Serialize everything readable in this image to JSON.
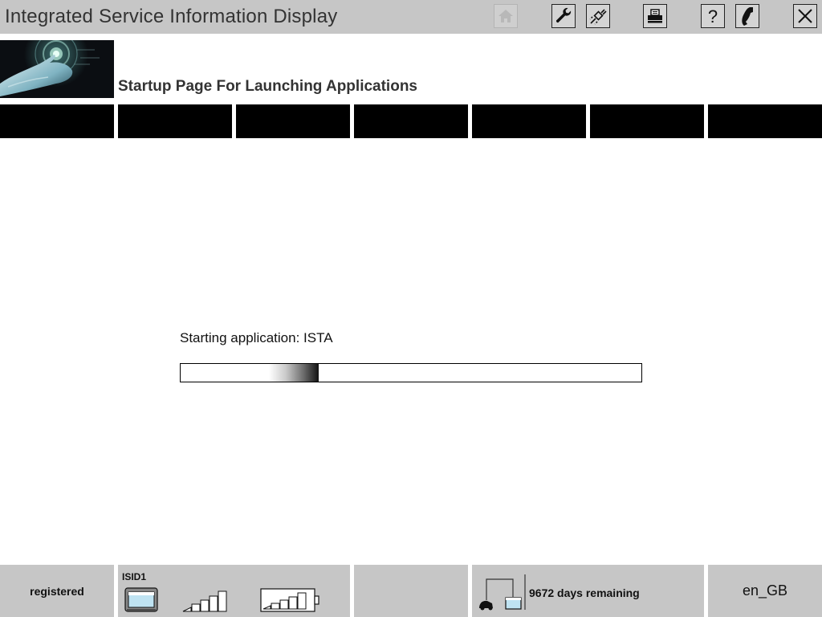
{
  "header": {
    "app_title": "Integrated Service Information Display",
    "subtitle": "Startup Page For Launching Applications",
    "toolbar": [
      {
        "id": "home",
        "icon": "home-icon",
        "enabled": false
      },
      {
        "id": "settings",
        "icon": "wrench-icon",
        "enabled": true
      },
      {
        "id": "connection",
        "icon": "plug-icon",
        "enabled": true
      },
      {
        "id": "print",
        "icon": "printer-icon",
        "enabled": true
      },
      {
        "id": "help",
        "icon": "help-icon",
        "enabled": true
      },
      {
        "id": "phone",
        "icon": "phone-icon",
        "enabled": true
      },
      {
        "id": "close",
        "icon": "close-icon",
        "enabled": true
      }
    ]
  },
  "nav": {
    "tabs": [
      "",
      "",
      "",
      "",
      "",
      "",
      ""
    ]
  },
  "main": {
    "status_text": "Starting application: ISTA",
    "progress": {
      "value_percent": 30
    }
  },
  "statusbar": {
    "registration": "registered",
    "device": {
      "name": "ISID1",
      "icons": [
        "tablet-icon",
        "signal-strength-icon",
        "battery-icon"
      ]
    },
    "license": {
      "days_remaining": "9672 days remaining",
      "icon": "workshop-connection-icon"
    },
    "language": "en_GB"
  },
  "colors": {
    "bar_background": "#c6c6c6",
    "tab_background": "#000000",
    "page_background": "#ffffff"
  }
}
